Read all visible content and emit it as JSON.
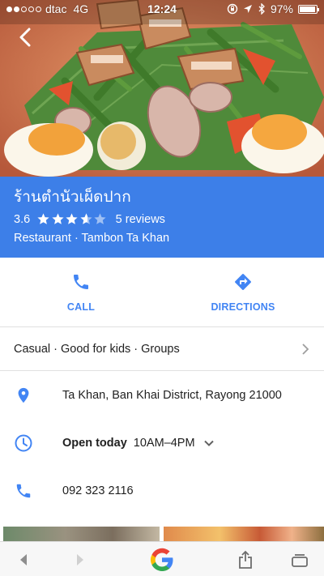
{
  "status_bar": {
    "signal_bars_filled": 2,
    "signal_bars_total": 5,
    "carrier": "dtac",
    "network": "4G",
    "time": "12:24",
    "battery_percent": "97%",
    "battery_level": 0.97,
    "icons": [
      "orientation-lock-icon",
      "location-arrow-icon",
      "bluetooth-icon",
      "battery-icon"
    ]
  },
  "hero": {
    "photo_icon": "food-photo",
    "back_icon": "back-arrow-icon"
  },
  "place": {
    "name": "ร้านตำนัวเผ็ดปาก",
    "rating": "3.6",
    "rating_value": 3.6,
    "rating_max": 5,
    "reviews": "5 reviews",
    "category": "Restaurant · Tambon Ta Khan"
  },
  "actions": [
    {
      "label": "CALL",
      "icon": "phone-icon"
    },
    {
      "label": "DIRECTIONS",
      "icon": "directions-icon"
    }
  ],
  "attributes": {
    "text": "Casual · Good for kids · Groups",
    "icon": "chevron-right-icon"
  },
  "address": {
    "text": "Ta Khan, Ban Khai District, Rayong 21000",
    "icon": "location-pin-icon"
  },
  "hours": {
    "status": "Open today",
    "range": "10AM–4PM",
    "icon": "clock-icon",
    "toggle_icon": "chevron-down-icon"
  },
  "phone": {
    "number": "092 323 2116",
    "icon": "phone-icon"
  },
  "toolbar": {
    "items": [
      "back-icon",
      "forward-icon",
      "google-logo",
      "share-icon",
      "tabs-icon"
    ]
  },
  "colors": {
    "accent_blue": "#4285f4",
    "title_band": "#3d7fe8",
    "star_filled": "#ffffff",
    "star_empty": "#9fc0f4"
  }
}
